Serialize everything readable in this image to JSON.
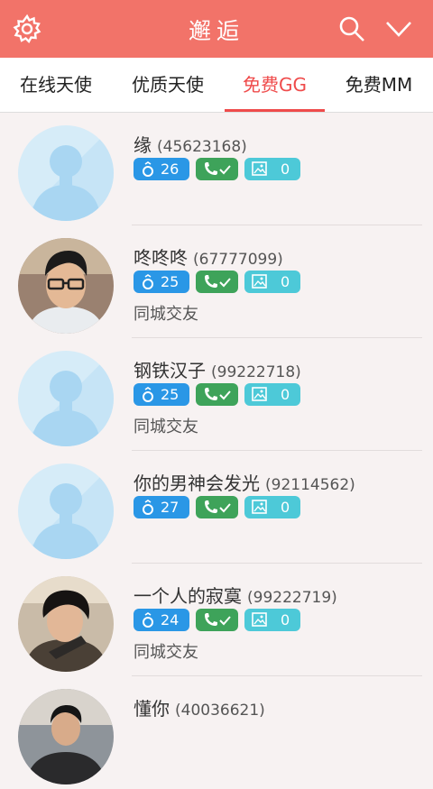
{
  "header": {
    "title": "邂逅",
    "icons": [
      "gear-icon",
      "search-icon",
      "chevron-down-icon"
    ],
    "color": "#f27369"
  },
  "tabs": [
    {
      "label": "在线天使",
      "active": false
    },
    {
      "label": "优质天使",
      "active": false
    },
    {
      "label": "免费GG",
      "active": true
    },
    {
      "label": "免费MM",
      "active": false
    }
  ],
  "accent_color": "#ef4b4b",
  "users": [
    {
      "name": "缘",
      "id": "(45623168)",
      "age": "26",
      "photos": "0",
      "tagline": "",
      "avatar": "default-avatar"
    },
    {
      "name": "咚咚咚",
      "id": "(67777099)",
      "age": "25",
      "photos": "0",
      "tagline": "同城交友",
      "avatar": "photo-avatar"
    },
    {
      "name": "钢铁汉子",
      "id": "(99222718)",
      "age": "25",
      "photos": "0",
      "tagline": "同城交友",
      "avatar": "default-avatar"
    },
    {
      "name": "你的男神会发光",
      "id": "(92114562)",
      "age": "27",
      "photos": "0",
      "tagline": "",
      "avatar": "default-avatar"
    },
    {
      "name": "一个人的寂寞",
      "id": "(99222719)",
      "age": "24",
      "photos": "0",
      "tagline": "同城交友",
      "avatar": "photo-avatar"
    },
    {
      "name": "懂你",
      "id": "(40036621)",
      "age": "",
      "photos": "",
      "tagline": "",
      "avatar": "photo-avatar"
    }
  ]
}
